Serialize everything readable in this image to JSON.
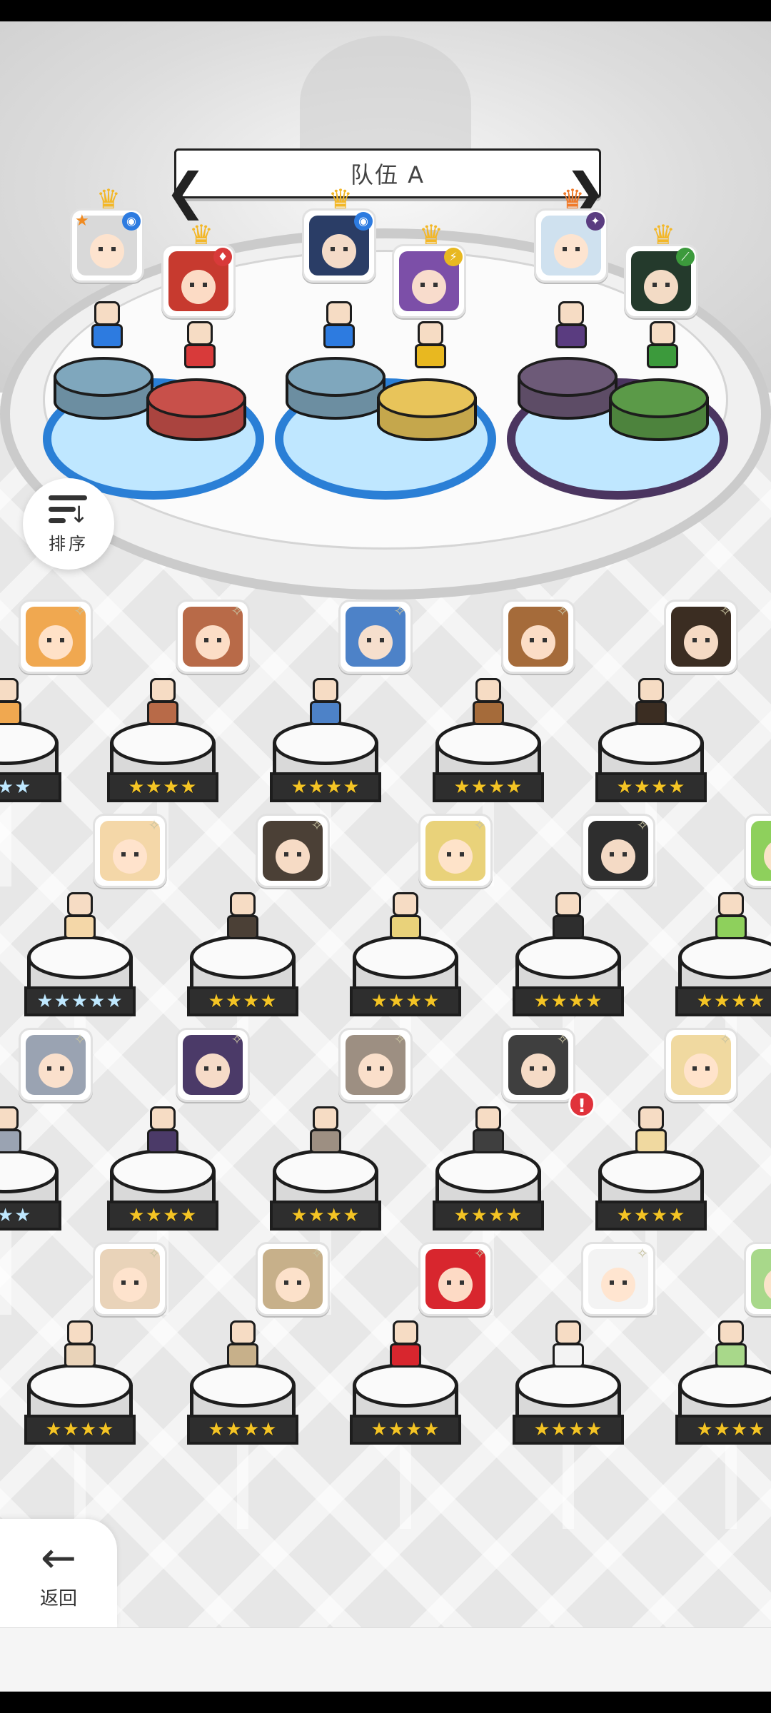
{
  "team": {
    "title": "队伍 A",
    "prev_arrow": "❮",
    "next_arrow": "❯"
  },
  "colors": {
    "pad_blue": "#7fa7bd",
    "pad_red": "#c8504a",
    "pad_yellow": "#e8c45a",
    "pad_purple": "#6d5a78",
    "pad_green": "#5b9a48",
    "ring_blue": "#2a7fd6",
    "ring_purple": "#4b3560",
    "alert_red": "#e0323b"
  },
  "team_slots": [
    {
      "element_icon": "water-element-icon",
      "element_glyph": "◉",
      "element_color": "#2d7be0",
      "crown_color": "gold",
      "leader_star": "★"
    },
    {
      "element_icon": "fire-element-icon",
      "element_glyph": "♦",
      "element_color": "#d83a3a",
      "crown_color": "gold"
    },
    {
      "element_icon": "water-element-icon",
      "element_glyph": "◉",
      "element_color": "#2d7be0",
      "crown_color": "gold"
    },
    {
      "element_icon": "lightning-element-icon",
      "element_glyph": "⚡",
      "element_color": "#e8b820",
      "crown_color": "gold"
    },
    {
      "element_icon": "dark-element-icon",
      "element_glyph": "✦",
      "element_color": "#5a3c80",
      "crown_color": "orange"
    },
    {
      "element_icon": "earth-element-icon",
      "element_glyph": "⟋",
      "element_color": "#3c9a3c",
      "crown_color": "gold"
    }
  ],
  "sort_button": {
    "label": "排序"
  },
  "back_button": {
    "label": "返回",
    "arrow": "←"
  },
  "roster": [
    {
      "row": 1,
      "stars": "★★★",
      "rainbow": true,
      "partial": true
    },
    {
      "row": 1,
      "stars": "★★★★"
    },
    {
      "row": 1,
      "stars": "★★★★"
    },
    {
      "row": 1,
      "stars": "★★★★"
    },
    {
      "row": 1,
      "stars": "★★★★"
    },
    {
      "row": 2,
      "stars": "★★★★★",
      "rainbow": true
    },
    {
      "row": 2,
      "stars": "★★★★"
    },
    {
      "row": 2,
      "stars": "★★★★"
    },
    {
      "row": 2,
      "stars": "★★★★"
    },
    {
      "row": 2,
      "stars": "★★★★"
    },
    {
      "row": 3,
      "stars": "★★★",
      "rainbow": true,
      "partial": true
    },
    {
      "row": 3,
      "stars": "★★★★"
    },
    {
      "row": 3,
      "stars": "★★★★"
    },
    {
      "row": 3,
      "stars": "★★★★",
      "alert": "!"
    },
    {
      "row": 3,
      "stars": "★★★★"
    },
    {
      "row": 4,
      "stars": "★★★★"
    },
    {
      "row": 4,
      "stars": "★★★★"
    },
    {
      "row": 4,
      "stars": "★★★★"
    },
    {
      "row": 4,
      "stars": "★★★★"
    },
    {
      "row": 4,
      "stars": "★★★★"
    }
  ],
  "sparkle_glyph": "✧"
}
